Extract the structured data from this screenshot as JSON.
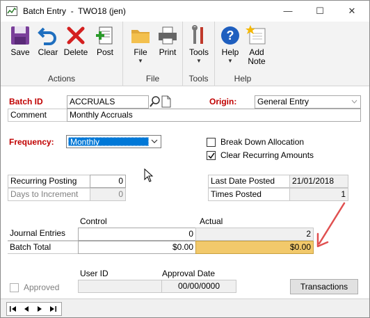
{
  "window": {
    "title": "Batch Entry  -  TWO18 (jen)",
    "controls": {
      "minimize": "—",
      "maximize": "☐",
      "close": "✕"
    }
  },
  "ribbon": {
    "groups": [
      {
        "label": "Actions",
        "buttons": [
          "Save",
          "Clear",
          "Delete",
          "Post"
        ]
      },
      {
        "label": "File",
        "buttons": [
          "File",
          "Print"
        ]
      },
      {
        "label": "Tools",
        "buttons": [
          "Tools"
        ]
      },
      {
        "label": "Help",
        "buttons": [
          "Help",
          "Add Note"
        ]
      }
    ],
    "add_note_line1": "Add",
    "add_note_line2": "Note"
  },
  "form": {
    "batch_id_label": "Batch ID",
    "batch_id_value": "ACCRUALS",
    "origin_label": "Origin:",
    "origin_value": "General Entry",
    "comment_label": "Comment",
    "comment_value": "Monthly Accruals",
    "frequency_label": "Frequency:",
    "frequency_value": "Monthly",
    "break_down_label": "Break Down Allocation",
    "break_down_checked": false,
    "clear_recurring_label": "Clear Recurring Amounts",
    "clear_recurring_checked": true,
    "recurring_posting_label": "Recurring Posting",
    "recurring_posting_value": "0",
    "days_to_increment_label": "Days to Increment",
    "days_to_increment_value": "0",
    "last_date_posted_label": "Last Date Posted",
    "last_date_posted_value": "21/01/2018",
    "times_posted_label": "Times Posted",
    "times_posted_value": "1",
    "control_header": "Control",
    "actual_header": "Actual",
    "journal_entries_label": "Journal Entries",
    "journal_entries_control": "0",
    "journal_entries_actual": "2",
    "batch_total_label": "Batch Total",
    "batch_total_control": "$0.00",
    "batch_total_actual": "$0.00",
    "user_id_label": "User ID",
    "approval_date_label": "Approval Date",
    "approved_label": "Approved",
    "user_id_value": "",
    "approval_date_value": "00/00/0000",
    "transactions_button": "Transactions"
  },
  "colors": {
    "required_label": "#c00000",
    "highlight": "#f2c96b",
    "selection": "#0078d7",
    "annotation_arrow": "#e05050"
  }
}
